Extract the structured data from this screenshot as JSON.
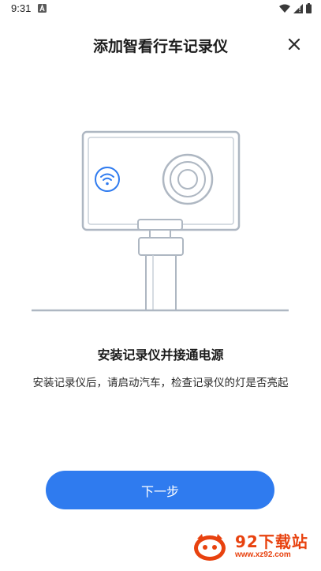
{
  "status_bar": {
    "time": "9:31",
    "notification_icon": "a-box-icon",
    "right_icons": [
      "wifi-icon",
      "signal-icon",
      "battery-icon"
    ]
  },
  "header": {
    "title": "添加智看行车记录仪",
    "close_icon": "close-icon"
  },
  "illustration": {
    "icons": [
      "dashcam-icon",
      "wifi-indicator-icon",
      "lens-icon",
      "mount-pole-icon"
    ],
    "colors": {
      "outline": "#aeb7c2",
      "wifi_accent": "#2f7bef"
    }
  },
  "step": {
    "title": "安装记录仪并接通电源",
    "description": "安装记录仪后，请启动汽车，检查记录仪的灯是否亮起"
  },
  "actions": {
    "next_label": "下一步"
  },
  "watermark": {
    "name": "92下载站",
    "url": "www.xz92.com"
  },
  "colors": {
    "primary": "#2f7bef",
    "watermark": "#e8420f"
  }
}
